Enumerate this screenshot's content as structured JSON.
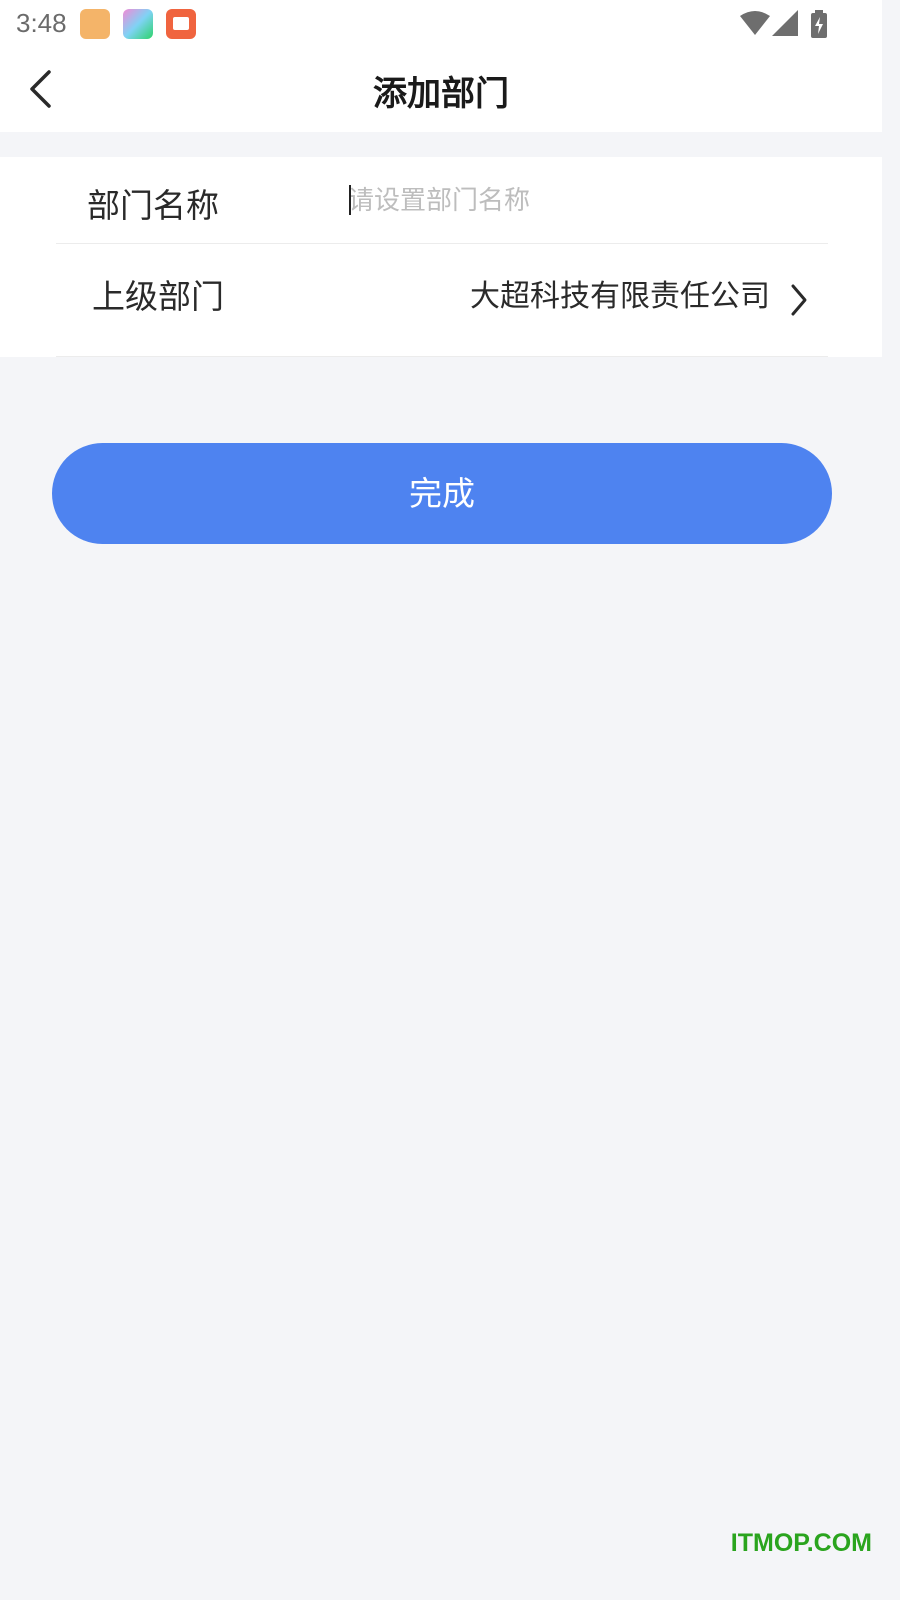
{
  "status_bar": {
    "time": "3:48",
    "notification_icons": [
      "cat-app-icon",
      "pyramid-app-icon",
      "book-app-icon"
    ],
    "system_icons": [
      "wifi-icon",
      "signal-icon",
      "battery-charging-icon"
    ]
  },
  "header": {
    "title": "添加部门",
    "back_icon": "chevron-left-icon"
  },
  "form": {
    "name_label": "部门名称",
    "name_value": "",
    "name_placeholder": "请设置部门名称",
    "parent_label": "上级部门",
    "parent_value": "大超科技有限责任公司",
    "parent_icon": "chevron-right-icon"
  },
  "actions": {
    "done_label": "完成"
  },
  "watermark": "ITMOP.COM",
  "colors": {
    "accent": "#4e83f0",
    "background": "#f4f5f8",
    "watermark": "#2aa41e"
  }
}
